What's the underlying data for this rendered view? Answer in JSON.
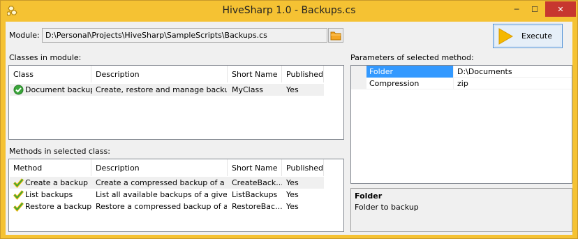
{
  "window": {
    "title": "HiveSharp 1.0 - Backups.cs",
    "min_glyph": "─",
    "max_glyph": "☐",
    "close_glyph": "✕"
  },
  "module": {
    "label": "Module:",
    "path": "D:\\Personal\\Projects\\HiveSharp\\SampleScripts\\Backups.cs"
  },
  "execute": {
    "label": "Execute"
  },
  "classes": {
    "label": "Classes in module:",
    "columns": [
      "Class",
      "Description",
      "Short Name",
      "Published"
    ],
    "rows": [
      {
        "name": "Document backups",
        "description": "Create, restore and manage backup...",
        "short_name": "MyClass",
        "published": "Yes"
      }
    ]
  },
  "methods": {
    "label": "Methods in selected class:",
    "columns": [
      "Method",
      "Description",
      "Short Name",
      "Published"
    ],
    "rows": [
      {
        "name": "Create a backup",
        "description": "Create a compressed backup of a gi...",
        "short_name": "CreateBack...",
        "published": "Yes"
      },
      {
        "name": "List backups",
        "description": "List all available backups of a given f...",
        "short_name": "ListBackups",
        "published": "Yes"
      },
      {
        "name": "Restore a backup",
        "description": "Restore a compressed backup of a ...",
        "short_name": "RestoreBac...",
        "published": "Yes"
      }
    ]
  },
  "parameters": {
    "label": "Parameters of selected method:",
    "rows": [
      {
        "name": "Folder",
        "value": "D:\\Documents"
      },
      {
        "name": "Compression",
        "value": "zip"
      }
    ]
  },
  "help": {
    "title": "Folder",
    "description": "Folder to backup"
  },
  "colors": {
    "titlebar": "#f5c233",
    "close_button": "#c7372f",
    "selection": "#3399ff",
    "check_green": "#3aa63a",
    "execute_arrow": "#f5b800"
  }
}
